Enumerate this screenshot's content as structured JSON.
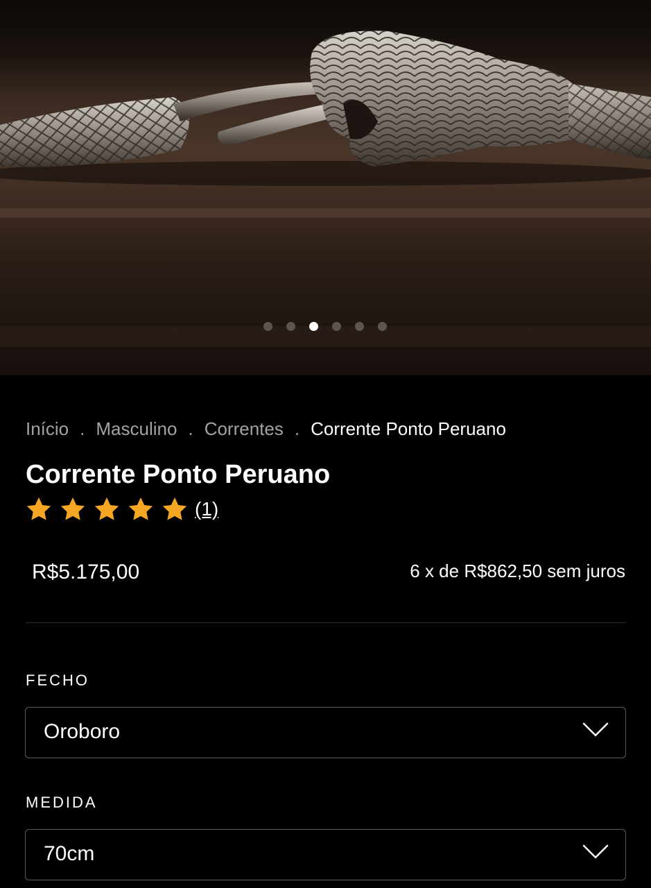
{
  "gallery": {
    "slide_count": 6,
    "active_index": 2,
    "image_alt": "Corrente Ponto Peruano"
  },
  "breadcrumb": [
    {
      "label": "Início"
    },
    {
      "label": "Masculino"
    },
    {
      "label": "Correntes"
    },
    {
      "label": "Corrente Ponto Peruano"
    }
  ],
  "breadcrumb_separator": ".",
  "product": {
    "title": "Corrente Ponto Peruano",
    "rating": 5,
    "rating_max": 5,
    "review_count": "(1)",
    "price": "R$5.175,00",
    "installments": "6 x de R$862,50 sem juros"
  },
  "options": {
    "fecho": {
      "label": "FECHO",
      "value": "Oroboro"
    },
    "medida": {
      "label": "MEDIDA",
      "value": "70cm"
    }
  },
  "colors": {
    "background": "#000000",
    "star": "#f5a623",
    "dot_active": "#ffffff",
    "dot_inactive": "#5d5550"
  }
}
